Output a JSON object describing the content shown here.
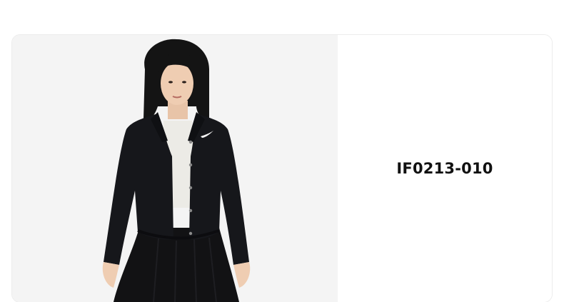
{
  "product": {
    "sku": "IF0213-010",
    "image": {
      "subject": "product-photo",
      "background_color": "#f4f4f4",
      "jacket_color": "#16171b",
      "skirt_color": "#121214",
      "top_color": "#ecebe6"
    },
    "logo_icon": "swoosh-icon"
  }
}
